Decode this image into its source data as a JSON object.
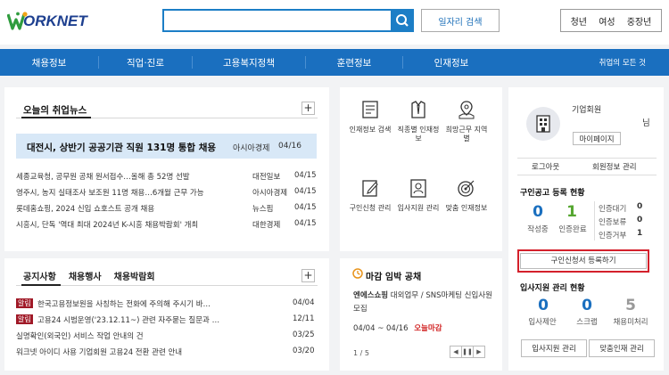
{
  "header": {
    "logo_text": "ORKNET",
    "search": {
      "value": "",
      "placeholder": ""
    },
    "job_search_label": "일자리 검색",
    "user_types": [
      "청년",
      "여성",
      "중장년"
    ]
  },
  "nav": {
    "items": [
      "채용정보",
      "직업·진로",
      "고용복지정책",
      "훈련정보",
      "인재정보"
    ],
    "more": "취업의 모든 것"
  },
  "news": {
    "title": "오늘의 취업뉴스",
    "headline": {
      "title": "대전시, 상반기 공공기관 직원 131명 통합 채용",
      "source": "아시아경제",
      "date": "04/16"
    },
    "items": [
      {
        "title": "세종교육청, 공무원 공채 원서접수…올해 총 52명 선발",
        "source": "대전일보",
        "date": "04/15"
      },
      {
        "title": "영주시, 농지 실태조사 보조원 11명 채용…6개월 근무 가능",
        "source": "아시아경제",
        "date": "04/15"
      },
      {
        "title": "롯데홈쇼핑, 2024 신입 쇼호스트 공개 채용",
        "source": "뉴스핌",
        "date": "04/15"
      },
      {
        "title": "시흥시, 단독 '역대 최대 2024년 K-시흥 채용박람회' 개최",
        "source": "대한경제",
        "date": "04/15"
      }
    ]
  },
  "notice": {
    "tabs": [
      "공지사항",
      "채용행사",
      "채용박람회"
    ],
    "items": [
      {
        "badge": "알림",
        "title": "한국고용정보원을 사칭하는 전화에 주의해 주시기 바…",
        "date": "04/04"
      },
      {
        "badge": "알림",
        "title": "고용24 시범운영('23.12.11~) 관련 자주묻는 질문과 …",
        "date": "12/11"
      },
      {
        "badge": "",
        "title": "실명확인(외국인) 서비스 작업 안내의 건",
        "date": "03/25"
      },
      {
        "badge": "",
        "title": "워크넷 아이디 사용 기업회원 고용24 전환 관련 안내",
        "date": "03/20"
      }
    ]
  },
  "quick_menu": [
    {
      "label": "인재정보 검색",
      "icon": "document-icon"
    },
    {
      "label": "직종별 인재정보",
      "icon": "suit-icon"
    },
    {
      "label": "희망근무 지역별",
      "icon": "map-pin-icon"
    },
    {
      "label": "구인신청 관리",
      "icon": "edit-form-icon"
    },
    {
      "label": "입사지원 관리",
      "icon": "id-card-icon"
    },
    {
      "label": "맞춤 인재정보",
      "icon": "target-icon"
    }
  ],
  "deadline": {
    "title": "마감 임박 공채",
    "company": "엔에스쇼핑",
    "body": " 대외업무 / SNS마케팅 신입사원 모집",
    "date_range": "04/04 ~ 04/16",
    "status": "오늘마감",
    "pager": "1 / 5"
  },
  "member": {
    "type": "기업회원",
    "suffix": "님",
    "mypage": "마이페이지",
    "logout": "로그아웃",
    "info_manage": "회원정보 관리",
    "job_status_title": "구인공고 등록 현황",
    "posted": {
      "value": "0",
      "label": "작성중"
    },
    "approved": {
      "value": "1",
      "label": "인증완료"
    },
    "side": [
      {
        "label": "인증대기",
        "value": "0"
      },
      {
        "label": "인증보류",
        "value": "0"
      },
      {
        "label": "인증거부",
        "value": "1"
      }
    ],
    "register_btn": "구인신청서 등록하기",
    "apply_title": "입사지원 관리 현황",
    "apply_stats": [
      {
        "value": "0",
        "label": "입사제안"
      },
      {
        "value": "0",
        "label": "스크랩"
      },
      {
        "value": "5",
        "label": "채용미처리"
      }
    ],
    "apply_manage": "입사지원 관리",
    "talent_manage": "맞춤인재 관리"
  },
  "colors": {
    "primary": "#1a6fbf",
    "highlight": "#d4202b",
    "green": "#55a630"
  }
}
